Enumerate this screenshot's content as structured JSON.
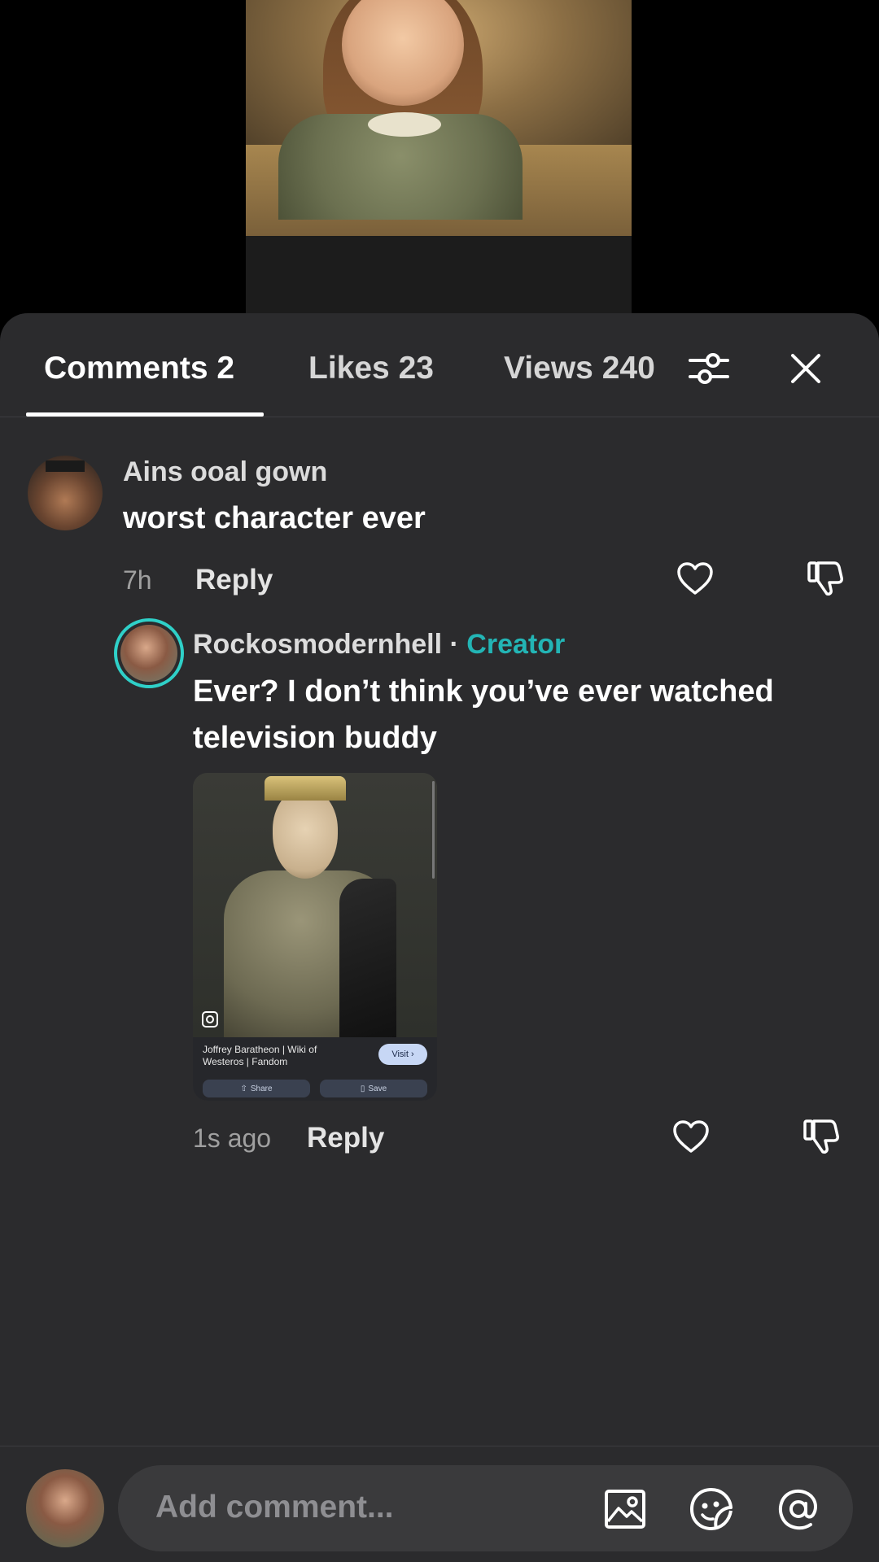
{
  "tabs": {
    "comments": "Comments 2",
    "likes": "Likes 23",
    "views": "Views 240"
  },
  "icons": {
    "filter": "sliders-icon",
    "close": "close-icon",
    "like": "heart-icon",
    "dislike": "thumbs-down-icon",
    "image": "image-icon",
    "sticker": "sticker-icon",
    "mention": "at-icon"
  },
  "comments": [
    {
      "username": "Ains ooal gown",
      "text": "worst character ever",
      "time": "7h",
      "reply_label": "Reply"
    },
    {
      "username": "Rockosmodernhell",
      "separator": " · ",
      "badge": "Creator",
      "text": "Ever? I don’t think you’ve ever watched television buddy",
      "time": "1s ago",
      "reply_label": "Reply",
      "attachment": {
        "title": "Joffrey Baratheon | Wiki of Westeros | Fandom",
        "visit": "Visit ›",
        "share": "Share",
        "save": "Save"
      }
    }
  ],
  "composer": {
    "placeholder": "Add comment..."
  },
  "colors": {
    "sheet_bg": "#2b2b2d",
    "creator_badge": "#23b5b5",
    "avatar_ring": "#2fd0c8"
  }
}
